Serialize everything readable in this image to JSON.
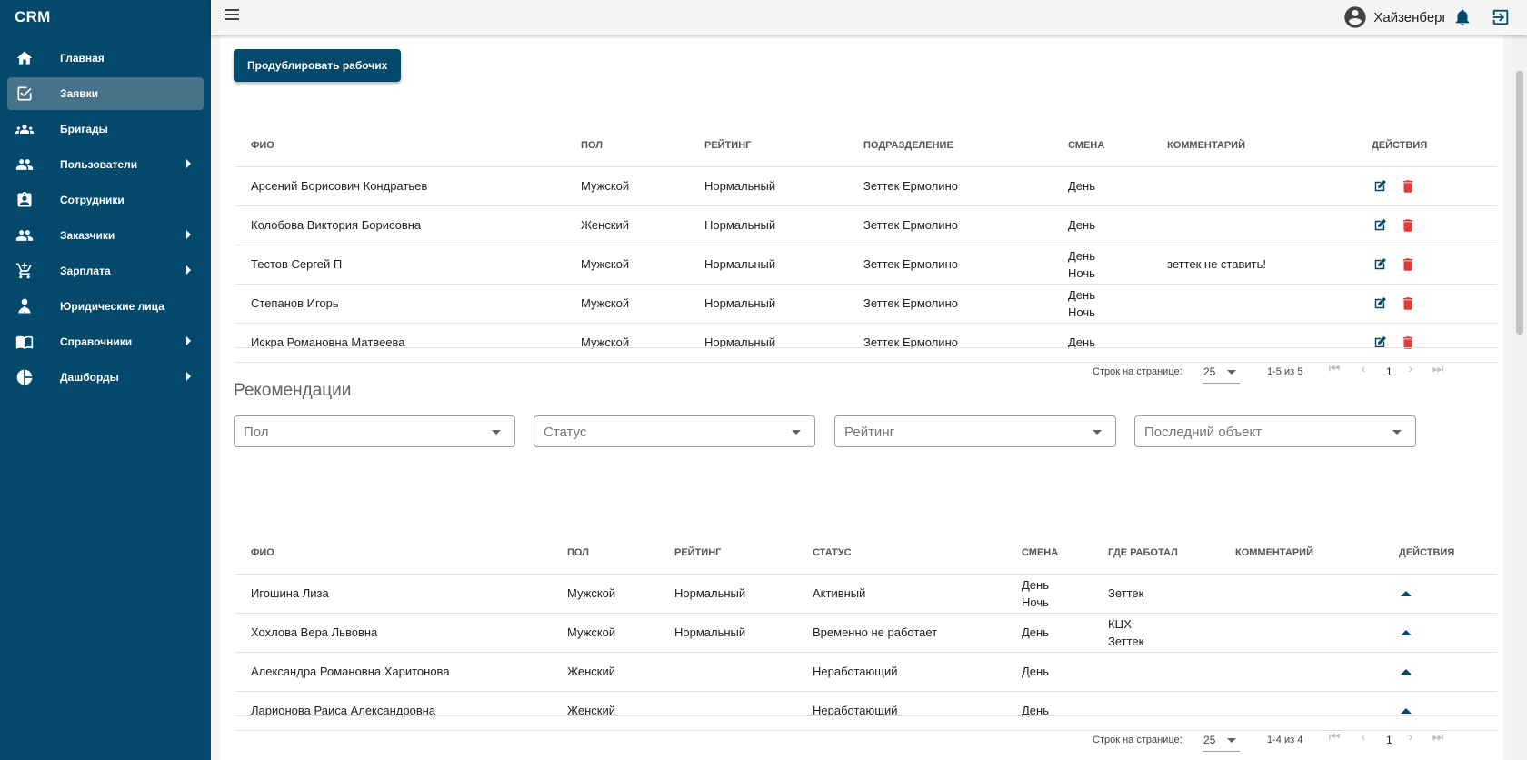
{
  "app": {
    "brand": "CRM",
    "user_name": "Хайзенберг"
  },
  "sidebar": {
    "items": [
      {
        "label": "Главная",
        "icon": "home-icon"
      },
      {
        "label": "Заявки",
        "icon": "checkbox-icon",
        "active": true
      },
      {
        "label": "Бригады",
        "icon": "groups-icon"
      },
      {
        "label": "Пользователи",
        "icon": "people-icon",
        "expandable": true
      },
      {
        "label": "Сотрудники",
        "icon": "badge-icon"
      },
      {
        "label": "Заказчики",
        "icon": "people-icon",
        "expandable": true
      },
      {
        "label": "Зарплата",
        "icon": "cart-icon",
        "expandable": true
      },
      {
        "label": "Юридические лица",
        "icon": "person-tie-icon"
      },
      {
        "label": "Справочники",
        "icon": "book-icon",
        "expandable": true
      },
      {
        "label": "Дашборды",
        "icon": "pie-chart-icon",
        "expandable": true
      }
    ]
  },
  "colors": {
    "sidebar": "#02496b",
    "active_item": "#48728a",
    "primary_button": "#02496b",
    "delete": "#e53935",
    "edit": "#02496b"
  },
  "workers": {
    "duplicate_button": "Продублировать рабочих",
    "headers": {
      "fio": "ФИО",
      "gender": "Пол",
      "rating": "Рейтинг",
      "division": "Подразделение",
      "shift": "Смена",
      "comment": "Комментарий",
      "actions": "Действия"
    },
    "rows": [
      {
        "fio": "Арсений Борисович Кондратьев",
        "gender": "Мужской",
        "rating": "Нормальный",
        "division": "Зеттек Ермолино",
        "shift1": "День",
        "shift2": "",
        "comment": ""
      },
      {
        "fio": "Колобова Виктория Борисовна",
        "gender": "Женский",
        "rating": "Нормальный",
        "division": "Зеттек Ермолино",
        "shift1": "День",
        "shift2": "",
        "comment": ""
      },
      {
        "fio": "Тестов Сергей П",
        "gender": "Мужской",
        "rating": "Нормальный",
        "division": "Зеттек Ермолино",
        "shift1": "День",
        "shift2": "Ночь",
        "comment": "зеттек не ставить!"
      },
      {
        "fio": "Степанов Игорь",
        "gender": "Мужской",
        "rating": "Нормальный",
        "division": "Зеттек Ермолино",
        "shift1": "День",
        "shift2": "Ночь",
        "comment": ""
      },
      {
        "fio": "Искра Романовна Матвеева",
        "gender": "Мужской",
        "rating": "Нормальный",
        "division": "Зеттек Ермолино",
        "shift1": "День",
        "shift2": "",
        "comment": ""
      }
    ],
    "pager": {
      "rows_label": "Строк на странице:",
      "rows_per_page": "25",
      "range": "1-5 из 5",
      "page": "1"
    }
  },
  "recommendations": {
    "title": "Рекомендации",
    "filters": {
      "gender": "Пол",
      "status": "Статус",
      "rating": "Рейтинг",
      "last_object": "Последний объект"
    },
    "headers": {
      "fio": "ФИО",
      "gender": "Пол",
      "rating": "Рейтинг",
      "status": "Статус",
      "shift": "Смена",
      "worked": "Где работал",
      "comment": "Комментарий",
      "actions": "Действия"
    },
    "rows": [
      {
        "fio": "Игошина Лиза",
        "gender": "Мужской",
        "rating": "Нормальный",
        "status": "Активный",
        "shift1": "День",
        "shift2": "Ночь",
        "worked1": "Зеттек",
        "worked2": "",
        "comment": ""
      },
      {
        "fio": "Хохлова Вера Львовна",
        "gender": "Мужской",
        "rating": "Нормальный",
        "status": "Временно не работает",
        "shift1": "День",
        "shift2": "",
        "worked1": "КЦХ",
        "worked2": "Зеттек",
        "comment": ""
      },
      {
        "fio": "Александра Романовна Харитонова",
        "gender": "Женский",
        "rating": "",
        "status": "Неработающий",
        "shift1": "День",
        "shift2": "",
        "worked1": "",
        "worked2": "",
        "comment": ""
      },
      {
        "fio": "Ларионова Раиса Александровна",
        "gender": "Женский",
        "rating": "",
        "status": "Неработающий",
        "shift1": "День",
        "shift2": "",
        "worked1": "",
        "worked2": "",
        "comment": ""
      }
    ],
    "pager": {
      "rows_label": "Строк на странице:",
      "rows_per_page": "25",
      "range": "1-4 из 4",
      "page": "1"
    }
  }
}
